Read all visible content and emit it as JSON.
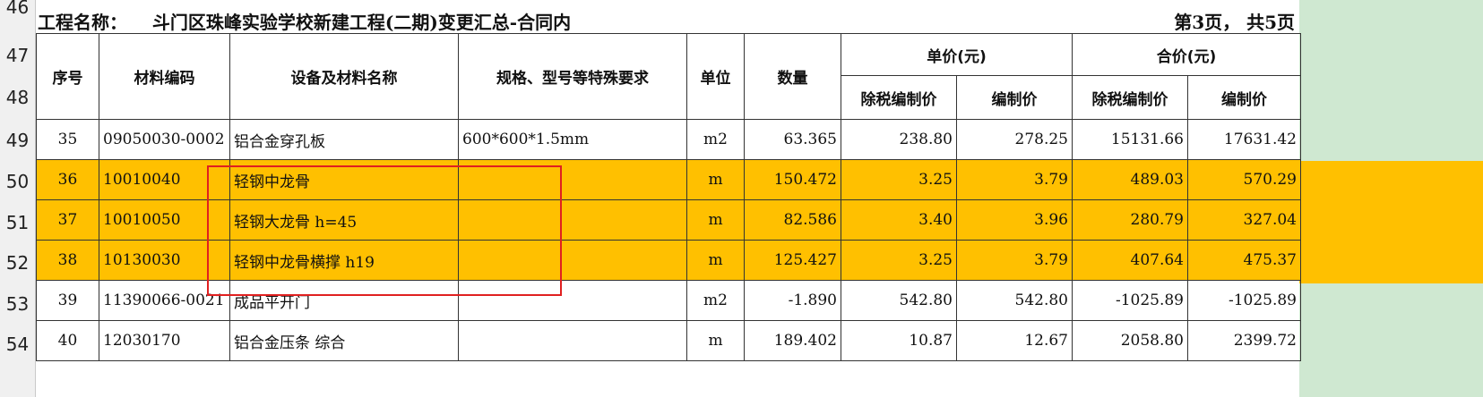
{
  "title": {
    "project_label": "工程名称：",
    "project_name": "斗门区珠峰实验学校新建工程(二期)变更汇总-合同内",
    "page_info": "第3页， 共5页"
  },
  "row_numbers": [
    "46",
    "47",
    "48",
    "49",
    "50",
    "51",
    "52",
    "53",
    "54"
  ],
  "headers": {
    "seq": "序号",
    "code": "材料编码",
    "name": "设备及材料名称",
    "spec": "规格、型号等特殊要求",
    "unit": "单位",
    "qty": "数量",
    "unit_price": "单价(元)",
    "total_price": "合价(元)",
    "ex_tax": "除税编制价",
    "price": "编制价",
    "ex_tax_total": "除税编制价",
    "price_total": "编制价"
  },
  "rows": [
    {
      "seq": "35",
      "code": "09050030-0002",
      "name": "铝合金穿孔板",
      "spec": "600*600*1.5mm",
      "unit": "m2",
      "qty": "63.365",
      "ut": "238.80",
      "up": "278.25",
      "tt": "15131.66",
      "tp": "17631.42",
      "highlight": false
    },
    {
      "seq": "36",
      "code": "10010040",
      "name": "轻钢中龙骨",
      "spec": "",
      "unit": "m",
      "qty": "150.472",
      "ut": "3.25",
      "up": "3.79",
      "tt": "489.03",
      "tp": "570.29",
      "highlight": true
    },
    {
      "seq": "37",
      "code": "10010050",
      "name": "轻钢大龙骨 h=45",
      "spec": "",
      "unit": "m",
      "qty": "82.586",
      "ut": "3.40",
      "up": "3.96",
      "tt": "280.79",
      "tp": "327.04",
      "highlight": true
    },
    {
      "seq": "38",
      "code": "10130030",
      "name": "轻钢中龙骨横撑 h19",
      "spec": "",
      "unit": "m",
      "qty": "125.427",
      "ut": "3.25",
      "up": "3.79",
      "tt": "407.64",
      "tp": "475.37",
      "highlight": true
    },
    {
      "seq": "39",
      "code": "11390066-0021",
      "name": "成品平开门",
      "spec": "",
      "unit": "m2",
      "qty": "-1.890",
      "ut": "542.80",
      "up": "542.80",
      "tt": "-1025.89",
      "tp": "-1025.89",
      "highlight": false
    },
    {
      "seq": "40",
      "code": "12030170",
      "name": "铝合金压条 综合",
      "spec": "",
      "unit": "m",
      "qty": "189.402",
      "ut": "10.87",
      "up": "12.67",
      "tt": "2058.80",
      "tp": "2399.72",
      "highlight": false
    }
  ],
  "colors": {
    "highlight": "#ffc000",
    "annotation_box": "#e02020",
    "side_pane": "#cfe8d1"
  }
}
